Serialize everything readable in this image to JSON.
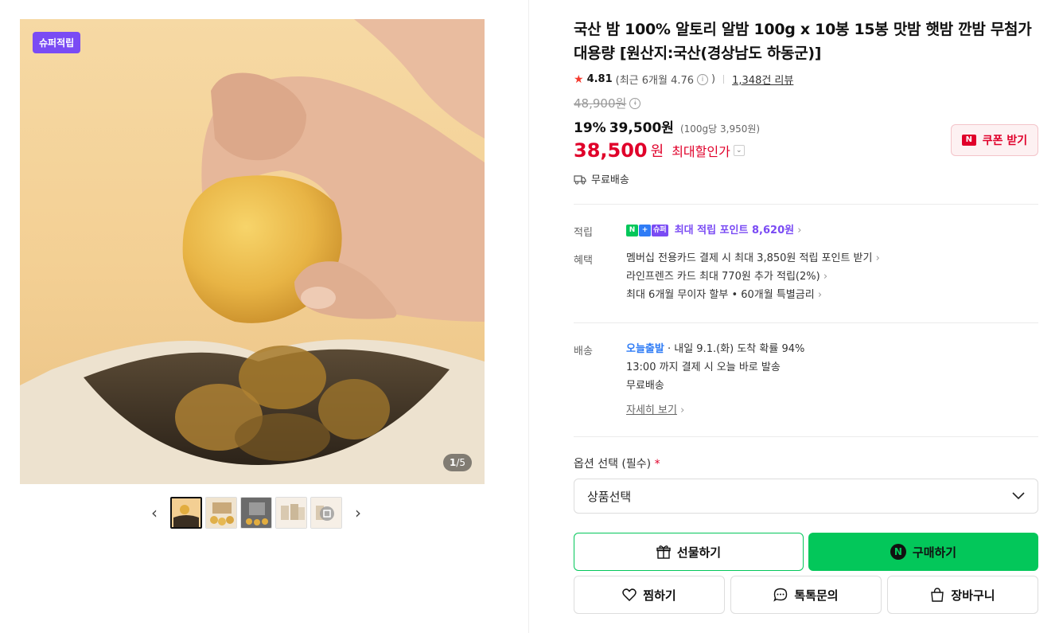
{
  "gallery": {
    "badge": "슈퍼적립",
    "counter_current": "1",
    "counter_total": "/5",
    "thumb_count": 5
  },
  "product": {
    "title": "국산 밤 100% 알토리 알밤 100g x 10봉 15봉 맛밤 햇밤 깐밤 무첨가 대용량 [원산지:국산(경상남도 하동군)]",
    "rating": "4.81",
    "recent_rating": "(최근 6개월 4.76",
    "recent_rating_close": ")",
    "reviews": "1,348건 리뷰",
    "original_price": "48,900원",
    "discount_pct": "19%",
    "sale_price": "39,500원",
    "unit_price": "(100g당 3,950원)",
    "best_price": "38,500",
    "best_won": "원",
    "best_label": "최대할인가",
    "coupon": "쿠폰 받기",
    "free_shipping": "무료배송"
  },
  "benefits": {
    "points_label": "적립",
    "points_text": "최대 적립 포인트 8,620원",
    "benefit_label": "혜택",
    "benefit_items": [
      "멤버십 전용카드 결제 시 최대 3,850원 적립 포인트 받기",
      "라인프렌즈 카드 최대 770원 추가 적립(2%)",
      "최대 6개월 무이자 할부 • 60개월 특별금리"
    ]
  },
  "delivery": {
    "label": "배송",
    "today": "오늘출발",
    "arrival": "· 내일 9.1.(화) 도착 확률 94%",
    "cutoff": "13:00 까지 결제 시 오늘 바로 발송",
    "free": "무료배송",
    "more": "자세히 보기"
  },
  "options": {
    "label": "옵션 선택 (필수)",
    "required_mark": "*",
    "select_placeholder": "상품선택"
  },
  "actions": {
    "gift": "선물하기",
    "buy": "구매하기",
    "wish": "찜하기",
    "talk": "톡톡문의",
    "cart": "장바구니"
  },
  "colors": {
    "naver_green": "#03c75a",
    "price_red": "#e0002a",
    "super_purple": "#7a4bf4"
  }
}
